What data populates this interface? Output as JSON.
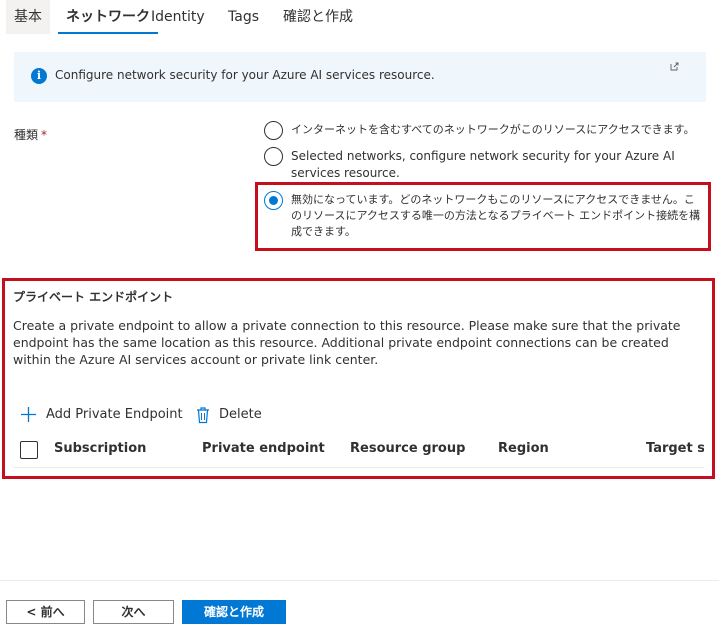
{
  "tabs": [
    {
      "label": "基本"
    },
    {
      "label": "ネットワーク"
    },
    {
      "label": "Identity"
    },
    {
      "label": "Tags"
    },
    {
      "label": "確認と作成"
    }
  ],
  "info": {
    "text": "Configure network security for your Azure AI services resource.",
    "icon": "info-icon"
  },
  "type_field": {
    "label": "種類",
    "required_mark": "*",
    "options": [
      {
        "label": "インターネットを含むすべてのネットワークがこのリソースにアクセスできます。",
        "selected": false
      },
      {
        "label": "Selected networks, configure network security for your Azure AI services resource.",
        "selected": false
      },
      {
        "label": "無効になっています。どのネットワークもこのリソースにアクセスできません。このリソースにアクセスする唯一の方法となるプライベート エンドポイント接続を構成できます。",
        "selected": true
      }
    ]
  },
  "private_endpoint": {
    "title": "プライベート エンドポイント",
    "description": "Create a private endpoint to allow a private connection to this resource. Please make sure that the private endpoint has the same location as this resource. Additional private endpoint connections can be created within the Azure AI services account or private link center.",
    "add_label": "Add Private Endpoint",
    "delete_label": "Delete",
    "columns": [
      "Subscription",
      "Private endpoint",
      "Resource group",
      "Region",
      "Target sub-resource"
    ]
  },
  "footer": {
    "prev_label": "< 前へ",
    "next_label": "次へ",
    "review_label": "確認と作成"
  },
  "colors": {
    "accent": "#0078d4",
    "highlight": "#c50f1f",
    "info_bg": "#eff6fc"
  }
}
